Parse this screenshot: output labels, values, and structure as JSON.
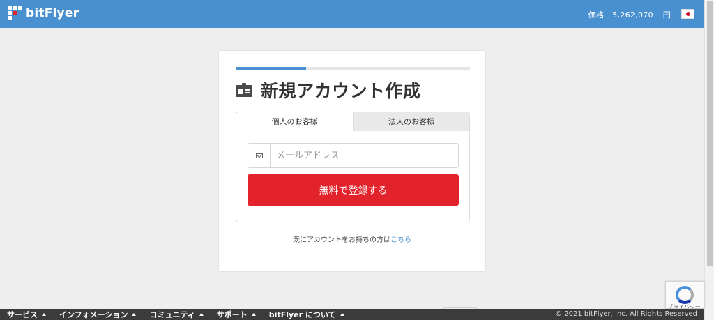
{
  "header": {
    "brand": "bitFlyer",
    "price_label": "価格",
    "price_value": "5,262,070",
    "price_unit": "円",
    "language_flag": "japan-flag-icon"
  },
  "signup": {
    "title": "新規アカウント作成",
    "progress_percent": 30,
    "tabs": [
      {
        "label": "個人のお客様",
        "active": true
      },
      {
        "label": "法人のお客様",
        "active": false
      }
    ],
    "email_placeholder": "メールアドレス",
    "email_value": "",
    "submit_label": "無料で登録する",
    "login_prompt": "既にアカウントをお持ちの方は",
    "login_link": "こちら"
  },
  "recaptcha": {
    "text": "プライバシー"
  },
  "footer": {
    "nav": [
      {
        "label": "サービス"
      },
      {
        "label": "インフォメーション"
      },
      {
        "label": "コミュニティ"
      },
      {
        "label": "サポート"
      },
      {
        "label": "bitFlyer について"
      }
    ],
    "copyright": "© 2021 bitFlyer, Inc. All Rights Reserved"
  },
  "colors": {
    "header": "#4890cf",
    "accent_red": "#e3232c",
    "footer": "#3b3b3b",
    "link": "#4890cf"
  }
}
